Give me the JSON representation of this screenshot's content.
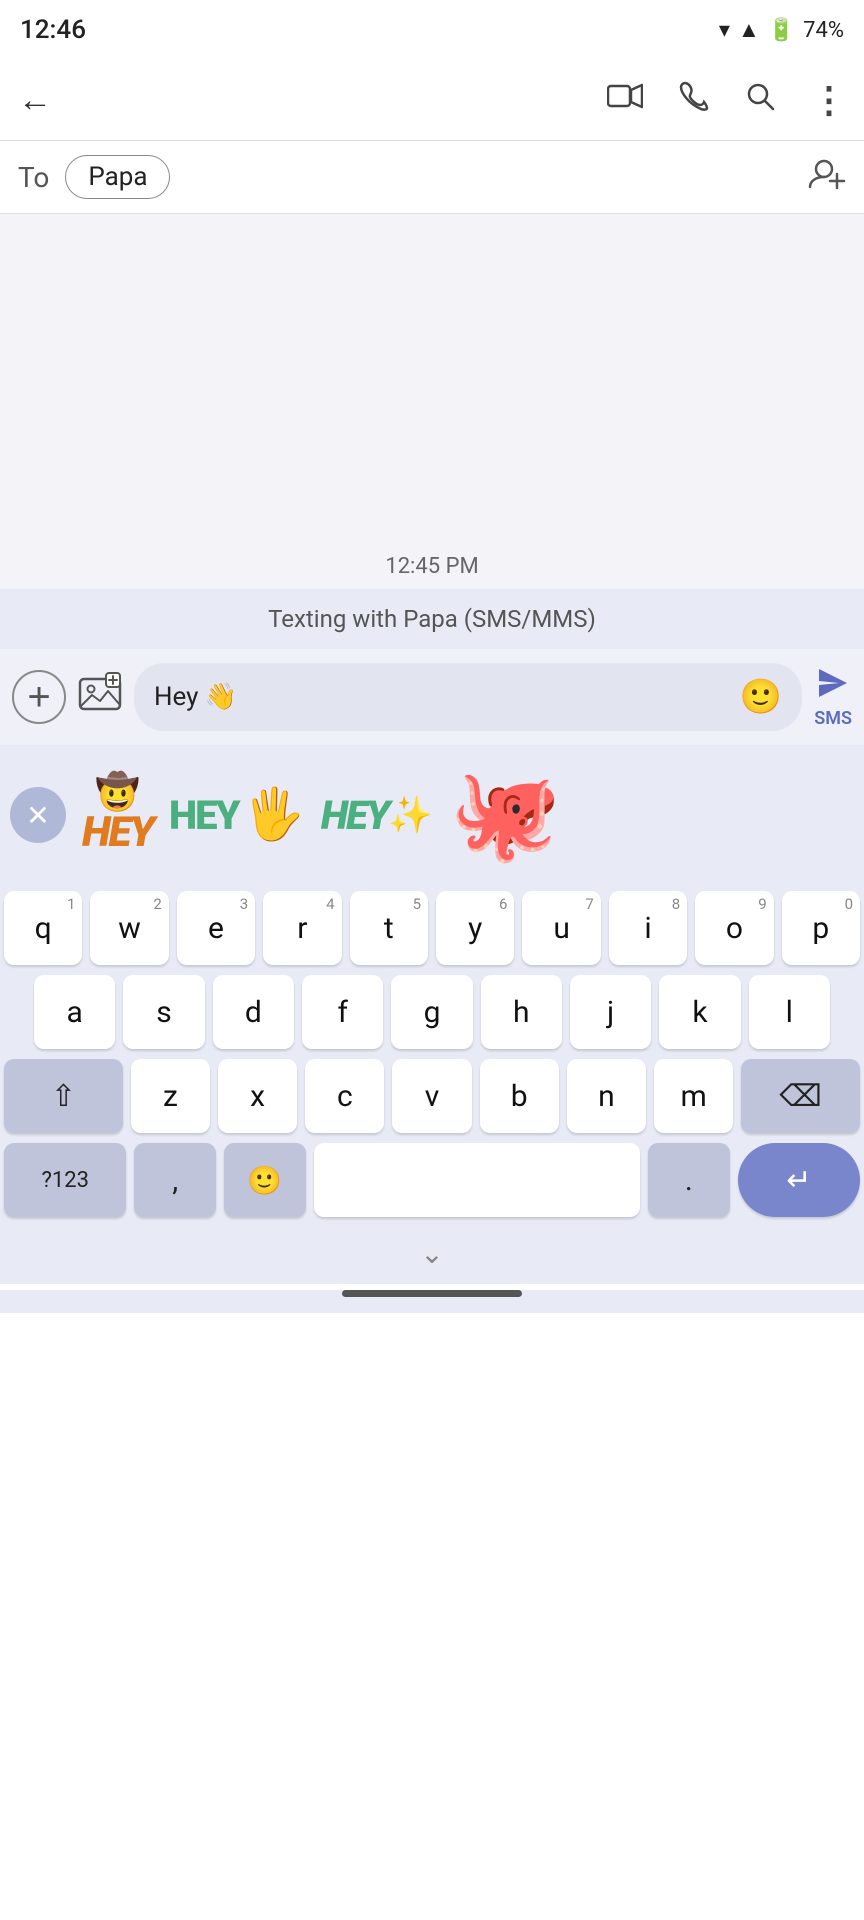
{
  "statusBar": {
    "time": "12:46",
    "battery": "74%"
  },
  "actionBar": {
    "backLabel": "←",
    "videoCallIcon": "📹",
    "phoneIcon": "📞",
    "searchIcon": "🔍",
    "moreIcon": "⋮"
  },
  "toField": {
    "label": "To",
    "recipient": "Papa",
    "addContactIcon": "👤+"
  },
  "messageArea": {
    "timestamp": "12:45 PM",
    "contextBanner": "Texting with Papa (SMS/MMS)"
  },
  "inputBar": {
    "addIcon": "+",
    "galleryIcon": "🖼",
    "messageText": "Hey 👋",
    "emojiIcon": "🙂",
    "sendLabel": "SMS"
  },
  "stickerBar": {
    "closeIcon": "✕",
    "stickers": [
      {
        "type": "hey-cowboy",
        "label": "HEY with cowboy hat"
      },
      {
        "type": "hey-hand",
        "label": "HEY with blue hand"
      },
      {
        "type": "hey-exclaim",
        "label": "HEY!"
      },
      {
        "type": "octopus",
        "label": "Happy octopus"
      }
    ]
  },
  "keyboard": {
    "row1": [
      {
        "char": "q",
        "num": "1"
      },
      {
        "char": "w",
        "num": "2"
      },
      {
        "char": "e",
        "num": "3"
      },
      {
        "char": "r",
        "num": "4"
      },
      {
        "char": "t",
        "num": "5"
      },
      {
        "char": "y",
        "num": "6"
      },
      {
        "char": "u",
        "num": "7"
      },
      {
        "char": "i",
        "num": "8"
      },
      {
        "char": "o",
        "num": "9"
      },
      {
        "char": "p",
        "num": "0"
      }
    ],
    "row2": [
      {
        "char": "a"
      },
      {
        "char": "s"
      },
      {
        "char": "d"
      },
      {
        "char": "f"
      },
      {
        "char": "g"
      },
      {
        "char": "h"
      },
      {
        "char": "j"
      },
      {
        "char": "k"
      },
      {
        "char": "l"
      }
    ],
    "row3": [
      {
        "char": "z"
      },
      {
        "char": "x"
      },
      {
        "char": "c"
      },
      {
        "char": "v"
      },
      {
        "char": "b"
      },
      {
        "char": "n"
      },
      {
        "char": "m"
      }
    ],
    "specialKeys": {
      "shift": "⇧",
      "delete": "⌫",
      "symbols": "?123",
      "comma": ",",
      "emoji": "🙂",
      "period": ".",
      "enter": "↵"
    }
  },
  "bottomBar": {
    "chevron": "⌄"
  }
}
